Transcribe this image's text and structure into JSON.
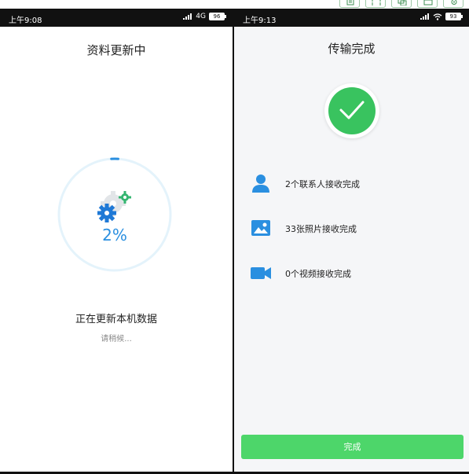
{
  "colors": {
    "accent_blue": "#2a8fe0",
    "success_green": "#39c35f",
    "button_green": "#4dd66a",
    "status_bar": "#111111",
    "right_bg": "#f5f6f8"
  },
  "top_toolbar": {
    "icons": [
      "document-icon",
      "expand-icon",
      "copy-icon",
      "window-icon",
      "settings-icon"
    ]
  },
  "left": {
    "status_bar": {
      "time": "上午9:08",
      "network": "4G",
      "battery": "96"
    },
    "title": "资料更新中",
    "progress": {
      "percent_label": "2%",
      "value": 0.02
    },
    "status_main": "正在更新本机数据",
    "status_sub": "请稍候..."
  },
  "right": {
    "status_bar": {
      "time": "上午9:13",
      "battery": "93"
    },
    "title": "传输完成",
    "items": [
      {
        "icon": "contact-icon",
        "label": "2个联系人接收完成"
      },
      {
        "icon": "photo-icon",
        "label": "33张照片接收完成"
      },
      {
        "icon": "video-icon",
        "label": "0个视频接收完成"
      }
    ],
    "done_button": "完成"
  }
}
